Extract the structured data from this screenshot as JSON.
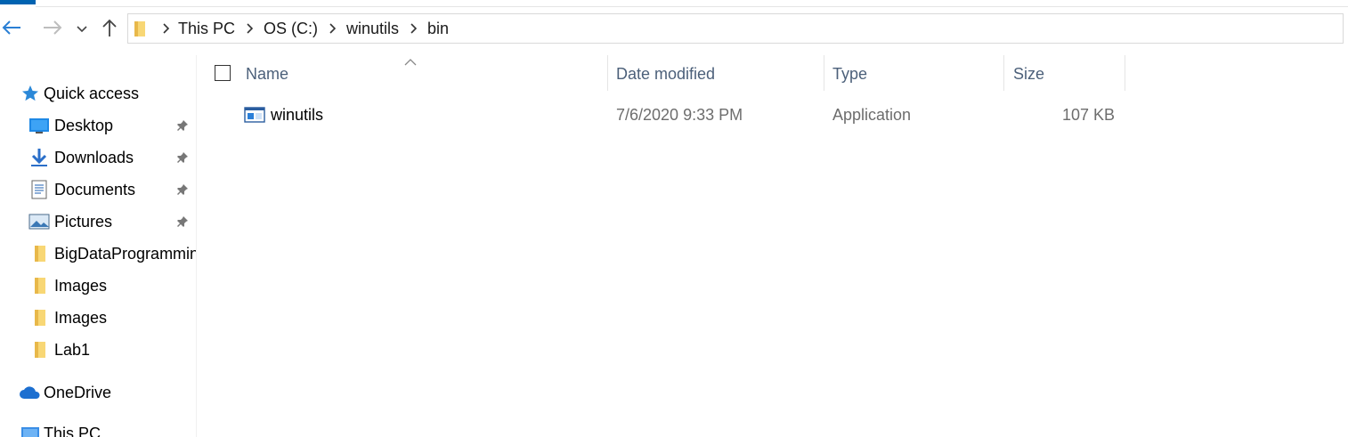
{
  "nav": {
    "back_icon": "back-arrow-icon",
    "forward_icon": "forward-arrow-icon",
    "recent_icon": "chevron-down-icon",
    "up_icon": "up-arrow-icon"
  },
  "breadcrumb": [
    "This PC",
    "OS (C:)",
    "winutils",
    "bin"
  ],
  "sidebar": {
    "quick_access": "Quick access",
    "items": [
      {
        "label": "Desktop",
        "icon": "desktop-icon",
        "pinned": true
      },
      {
        "label": "Downloads",
        "icon": "downloads-icon",
        "pinned": true
      },
      {
        "label": "Documents",
        "icon": "documents-icon",
        "pinned": true
      },
      {
        "label": "Pictures",
        "icon": "pictures-icon",
        "pinned": true
      },
      {
        "label": "BigDataProgramming",
        "icon": "folder-icon",
        "pinned": false
      },
      {
        "label": "Images",
        "icon": "folder-icon",
        "pinned": false
      },
      {
        "label": "Images",
        "icon": "folder-icon",
        "pinned": false
      },
      {
        "label": "Lab1",
        "icon": "folder-icon",
        "pinned": false
      }
    ],
    "onedrive": "OneDrive",
    "this_pc": "This PC"
  },
  "columns": {
    "name": "Name",
    "date": "Date modified",
    "type": "Type",
    "size": "Size"
  },
  "files": [
    {
      "name": "winutils",
      "date": "7/6/2020 9:33 PM",
      "type": "Application",
      "size": "107 KB",
      "icon": "application-icon"
    }
  ],
  "colors": {
    "accent": "#0063b1",
    "folder": "#f8d775",
    "header_text": "#4c607a",
    "detail_text": "#6d6d6d"
  }
}
